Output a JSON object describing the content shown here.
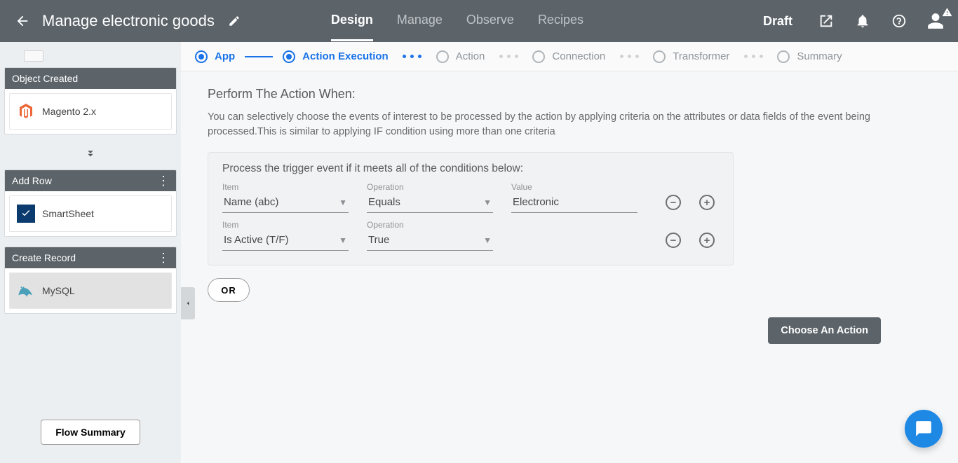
{
  "topbar": {
    "title": "Manage electronic goods",
    "tabs": [
      "Design",
      "Manage",
      "Observe",
      "Recipes"
    ],
    "active_tab_index": 0,
    "status": "Draft"
  },
  "sidebar": {
    "cards": [
      {
        "title": "Object Created",
        "item": "Magento 2.x",
        "kebab": false,
        "selected": false
      },
      {
        "title": "Add Row",
        "item": "SmartSheet",
        "kebab": true,
        "selected": false
      },
      {
        "title": "Create Record",
        "item": "MySQL",
        "kebab": true,
        "selected": true
      }
    ],
    "flow_summary": "Flow Summary"
  },
  "stepper": [
    {
      "label": "App",
      "state": "done"
    },
    {
      "label": "Action Execution",
      "state": "active"
    },
    {
      "label": "Action",
      "state": "todo"
    },
    {
      "label": "Connection",
      "state": "todo"
    },
    {
      "label": "Transformer",
      "state": "todo"
    },
    {
      "label": "Summary",
      "state": "todo"
    }
  ],
  "main": {
    "heading": "Perform The Action When:",
    "description": "You can selectively choose the events of interest to be processed by the action by applying criteria on the attributes or data fields of the event being processed.This is similar to applying IF condition using more than one criteria",
    "panel_title": "Process the trigger event if it meets all of the conditions below:",
    "labels": {
      "item": "Item",
      "operation": "Operation",
      "value": "Value"
    },
    "conditions": [
      {
        "item": "Name (abc)",
        "operation": "Equals",
        "value": "Electronic",
        "show_value": true
      },
      {
        "item": "Is Active (T/F)",
        "operation": "True",
        "value": "",
        "show_value": false
      }
    ],
    "or_label": "OR",
    "choose_action": "Choose An Action"
  }
}
